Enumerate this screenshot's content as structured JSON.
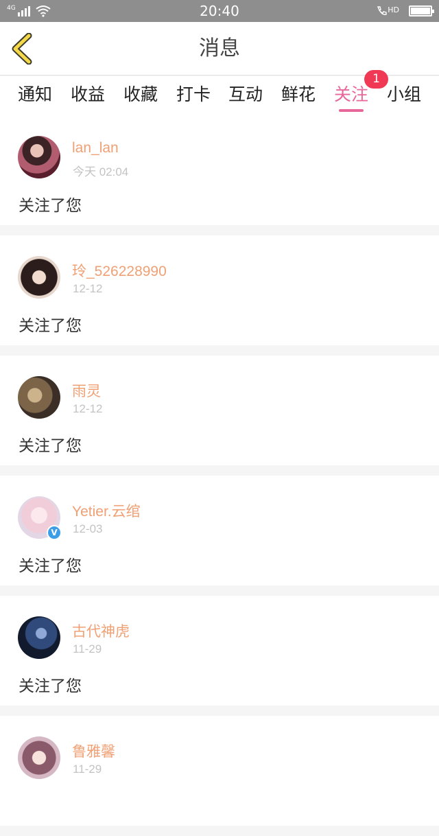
{
  "status_bar": {
    "network": "4G",
    "time": "20:40",
    "call_label": "HD"
  },
  "header": {
    "title": "消息",
    "back_icon": "chevron-left-icon",
    "accent_color": "#e8679b"
  },
  "tabs": [
    {
      "label": "通知"
    },
    {
      "label": "收益"
    },
    {
      "label": "收藏"
    },
    {
      "label": "打卡"
    },
    {
      "label": "互动"
    },
    {
      "label": "鲜花"
    },
    {
      "label": "关注",
      "active": true,
      "badge": "1"
    },
    {
      "label": "小组"
    }
  ],
  "messages": [
    {
      "name": "lan_lan",
      "time": "今天 02:04",
      "text": "关注了您",
      "verified": false
    },
    {
      "name": "玲_526228990",
      "time": "12-12",
      "text": "关注了您",
      "verified": false
    },
    {
      "name": "雨灵",
      "time": "12-12",
      "text": "关注了您",
      "verified": false
    },
    {
      "name": "Yetier.云绾",
      "time": "12-03",
      "text": "关注了您",
      "verified": true
    },
    {
      "name": "古代神虎",
      "time": "11-29",
      "text": "关注了您",
      "verified": false
    },
    {
      "name": "鲁雅馨",
      "time": "11-29",
      "text": "",
      "verified": false
    }
  ]
}
